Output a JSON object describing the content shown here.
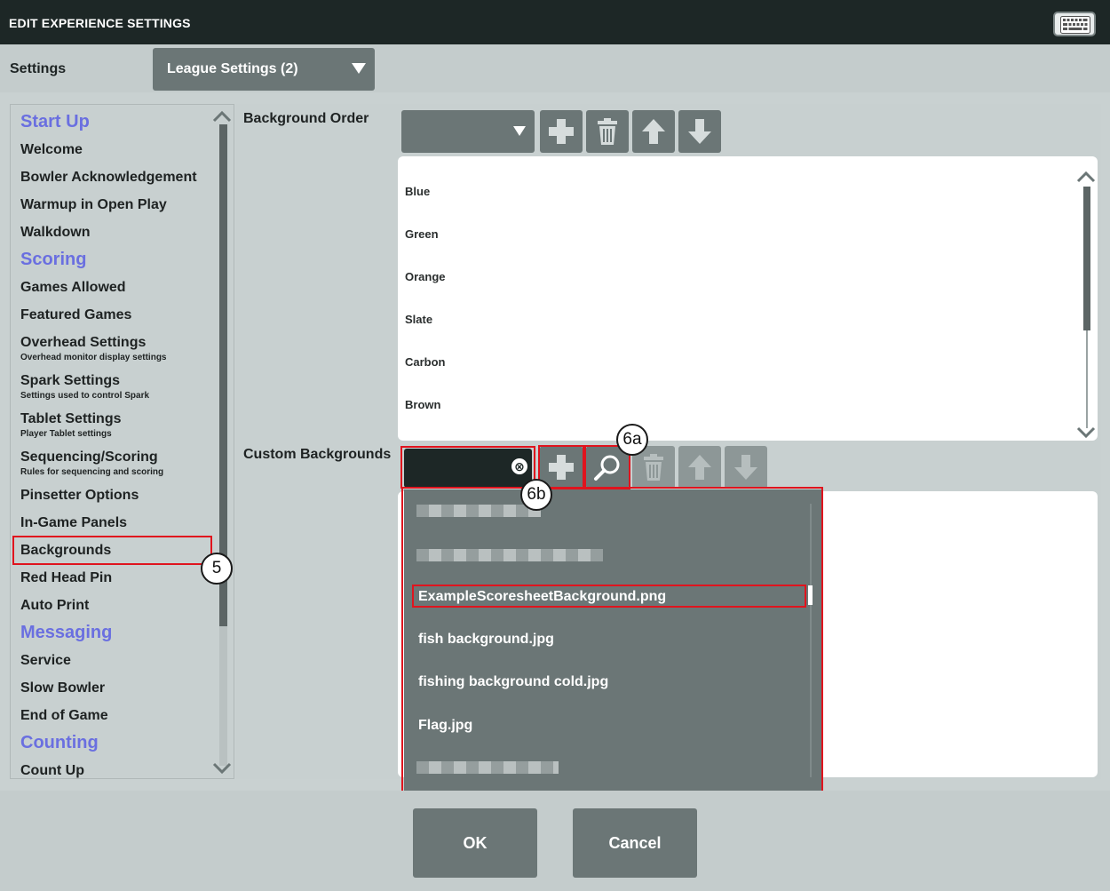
{
  "window": {
    "title": "EDIT EXPERIENCE SETTINGS",
    "keyboard_icon": "keyboard-icon"
  },
  "settings": {
    "label": "Settings",
    "selected": "League Settings (2)"
  },
  "nav": {
    "items": [
      {
        "label": "Start Up",
        "type": "category"
      },
      {
        "label": "Welcome"
      },
      {
        "label": "Bowler Acknowledgement"
      },
      {
        "label": "Warmup in Open Play"
      },
      {
        "label": "Walkdown"
      },
      {
        "label": "Scoring",
        "type": "category"
      },
      {
        "label": "Games Allowed"
      },
      {
        "label": "Featured Games"
      },
      {
        "label": "Overhead Settings",
        "sub": "Overhead monitor display settings"
      },
      {
        "label": "Spark Settings",
        "sub": "Settings used to control Spark"
      },
      {
        "label": "Tablet Settings",
        "sub": "Player Tablet settings"
      },
      {
        "label": "Sequencing/Scoring",
        "sub": "Rules for sequencing and scoring"
      },
      {
        "label": "Pinsetter Options"
      },
      {
        "label": "In-Game Panels"
      },
      {
        "label": "Backgrounds",
        "selected": true
      },
      {
        "label": "Red Head Pin"
      },
      {
        "label": "Auto Print"
      },
      {
        "label": "Messaging",
        "type": "category"
      },
      {
        "label": "Service"
      },
      {
        "label": "Slow Bowler"
      },
      {
        "label": "End of Game"
      },
      {
        "label": "Counting",
        "type": "category"
      },
      {
        "label": "Count Up"
      }
    ]
  },
  "background_order": {
    "label": "Background Order",
    "items": [
      "Blue",
      "Green",
      "Orange",
      "Slate",
      "Carbon",
      "Brown"
    ]
  },
  "custom_backgrounds": {
    "label": "Custom Backgrounds",
    "search_value": "",
    "clear_icon": "⊗",
    "options": [
      "ExampleScoresheetBackground.png",
      "fish background.jpg",
      "fishing background cold.jpg",
      "Flag.jpg"
    ],
    "highlighted": "ExampleScoresheetBackground.png"
  },
  "callouts": {
    "c5": "5",
    "c6a": "6a",
    "c6b": "6b"
  },
  "buttons": {
    "ok": "OK",
    "cancel": "Cancel"
  },
  "colors": {
    "accent_category": "#6a6fe0",
    "button": "#6b7676",
    "annotation": "#e0141e",
    "titlebar": "#1d2726"
  }
}
